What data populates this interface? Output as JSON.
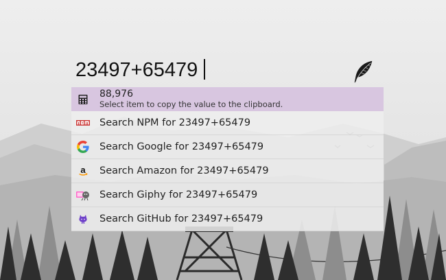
{
  "search": {
    "query": "23497+65479"
  },
  "results": [
    {
      "icon": "calculator-icon",
      "value": "88,976",
      "subtitle": "Select item to copy the value to the clipboard."
    },
    {
      "icon": "npm-icon",
      "label": "Search NPM for 23497+65479"
    },
    {
      "icon": "google-icon",
      "label": "Search Google for 23497+65479"
    },
    {
      "icon": "amazon-icon",
      "label": "Search Amazon for 23497+65479"
    },
    {
      "icon": "giphy-icon",
      "label": "Search Giphy for 23497+65479"
    },
    {
      "icon": "github-icon",
      "label": "Search GitHub for 23497+65479"
    }
  ],
  "colors": {
    "selected": "#d8c6e0",
    "npm": "#cb3837",
    "github": "#6e40c9"
  }
}
